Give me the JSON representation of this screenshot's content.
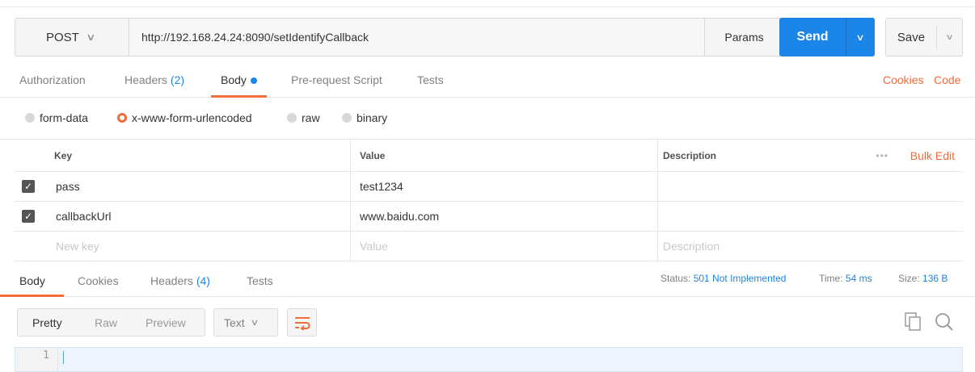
{
  "request": {
    "method": "POST",
    "url": "http://192.168.24.24:8090/setIdentifyCallback",
    "params_label": "Params",
    "send_label": "Send",
    "save_label": "Save"
  },
  "request_tabs": {
    "authorization": "Authorization",
    "headers": "Headers",
    "headers_count": "(2)",
    "body": "Body",
    "prerequest": "Pre-request Script",
    "tests": "Tests",
    "cookies_link": "Cookies",
    "code_link": "Code"
  },
  "body_types": {
    "form_data": "form-data",
    "urlencoded": "x-www-form-urlencoded",
    "raw": "raw",
    "binary": "binary",
    "selected": "x-www-form-urlencoded"
  },
  "params_table": {
    "headers": {
      "key": "Key",
      "value": "Value",
      "description": "Description"
    },
    "more": "•••",
    "bulk_edit": "Bulk Edit",
    "rows": [
      {
        "checked": true,
        "key": "pass",
        "value": "test1234",
        "description": ""
      },
      {
        "checked": true,
        "key": "callbackUrl",
        "value": "www.baidu.com",
        "description": ""
      }
    ],
    "new_row": {
      "key": "New key",
      "value": "Value",
      "description": "Description"
    }
  },
  "response": {
    "tabs": {
      "body": "Body",
      "cookies": "Cookies",
      "headers": "Headers",
      "headers_count": "(4)",
      "tests": "Tests"
    },
    "status_label": "Status:",
    "status_value": "501 Not Implemented",
    "time_label": "Time:",
    "time_value": "54 ms",
    "size_label": "Size:",
    "size_value": "136 B",
    "views": {
      "pretty": "Pretty",
      "raw": "Raw",
      "preview": "Preview"
    },
    "format": "Text",
    "line_number": "1"
  },
  "colors": {
    "accent": "#f26b3a",
    "send": "#1c85e8",
    "link_blue": "#1c85e8"
  }
}
